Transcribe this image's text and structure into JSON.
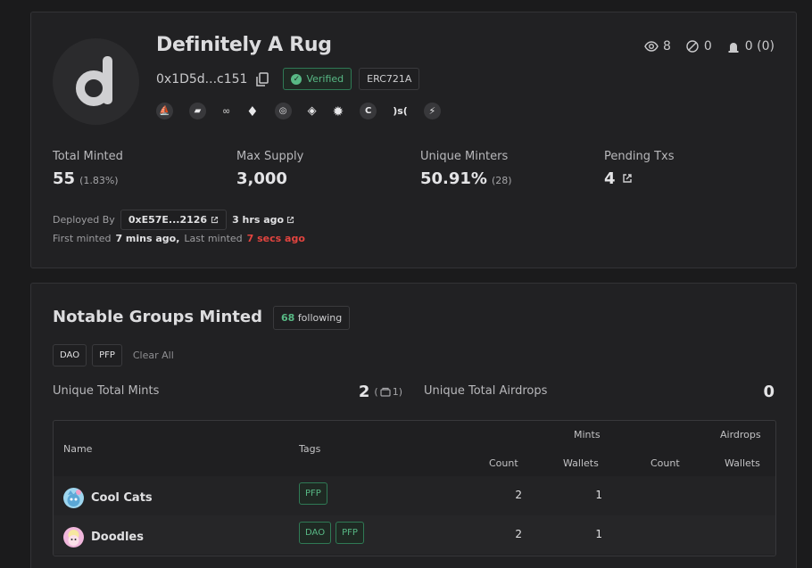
{
  "collection": {
    "title": "Definitely A Rug",
    "address": "0x1D5d...c151",
    "verified_label": "Verified",
    "standard": "ERC721A",
    "stats": {
      "views": "8",
      "hidden": "0",
      "alerts": "0 (0)"
    },
    "links": [
      "opensea",
      "looksrare",
      "x2y2",
      "gem",
      "rarible",
      "blur",
      "element",
      "coinbase",
      "sudoswap",
      "zora"
    ],
    "sudoswap_text": ")s("
  },
  "metrics": {
    "total_minted": {
      "label": "Total Minted",
      "value": "55",
      "sub": "(1.83%)"
    },
    "max_supply": {
      "label": "Max Supply",
      "value": "3,000"
    },
    "unique_minters": {
      "label": "Unique Minters",
      "value": "50.91%",
      "sub": "(28)"
    },
    "pending_txs": {
      "label": "Pending Txs",
      "value": "4"
    }
  },
  "deploy": {
    "deployed_by_label": "Deployed By",
    "deployer": "0xE57E...2126",
    "deployed_time": "3 hrs ago",
    "first_minted_label": "First minted",
    "first_minted": "7 mins ago,",
    "last_minted_label": "Last minted",
    "last_minted": "7 secs ago"
  },
  "groups": {
    "title": "Notable Groups Minted",
    "following_count": "68",
    "following_label": "following",
    "filters": [
      "DAO",
      "PFP"
    ],
    "clear_label": "Clear All",
    "unique_total_mints_label": "Unique Total Mints",
    "unique_total_mints_value": "2",
    "unique_total_mints_sub": "1)",
    "unique_total_airdrops_label": "Unique Total Airdrops",
    "unique_total_airdrops_value": "0"
  },
  "table": {
    "headers": {
      "name": "Name",
      "tags": "Tags",
      "mints": "Mints",
      "airdrops": "Airdrops",
      "mints_count": "Count",
      "mints_wallets": "Wallets",
      "airdrops_count": "Count",
      "airdrops_wallets": "Wallets"
    },
    "rows": [
      {
        "name": "Cool Cats",
        "tags": [
          "PFP"
        ],
        "mint_count": "2",
        "mint_wallets": "1",
        "airdrop_count": "",
        "airdrop_wallets": ""
      },
      {
        "name": "Doodles",
        "tags": [
          "DAO",
          "PFP"
        ],
        "mint_count": "2",
        "mint_wallets": "1",
        "airdrop_count": "",
        "airdrop_wallets": ""
      }
    ]
  },
  "colors": {
    "accent_green": "#58b985",
    "alert_red": "#e2443f",
    "background": "#1b1b1c",
    "card": "#212123"
  }
}
